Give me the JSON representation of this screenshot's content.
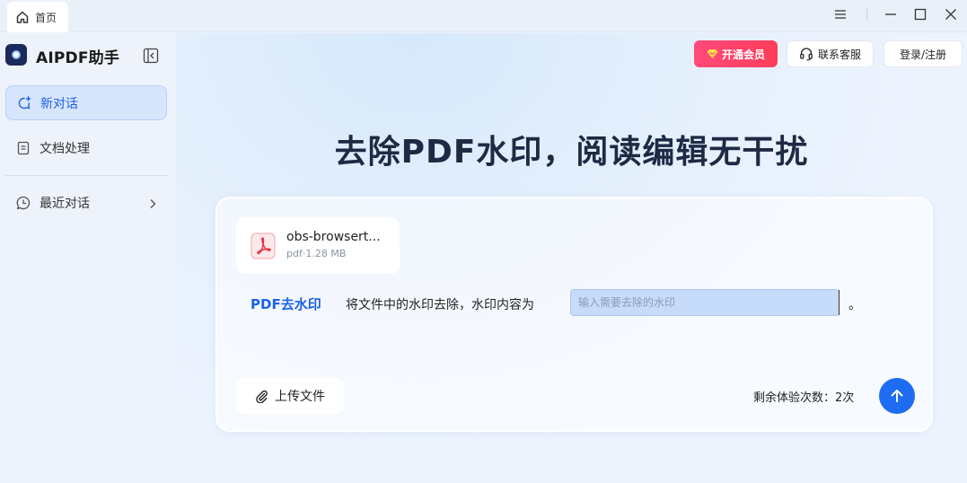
{
  "titlebar": {
    "tab_label": "首页",
    "tab_icon": "home-icon",
    "controls": [
      "menu-icon",
      "minimize-icon",
      "maximize-icon",
      "close-icon"
    ]
  },
  "sidebar": {
    "brand": "AIPDF助手",
    "items": [
      {
        "label": "新对话",
        "icon": "new-chat-icon",
        "active": true
      },
      {
        "label": "文档处理",
        "icon": "document-icon",
        "active": false
      },
      {
        "label": "最近对话",
        "icon": "history-chat-icon",
        "active": false
      }
    ]
  },
  "header": {
    "vip_label": "开通会员",
    "service_label": "联系客服",
    "login_label": "登录/注册"
  },
  "main": {
    "headline": "去除PDF水印，阅读编辑无干扰",
    "file": {
      "name": "obs-browsert...",
      "meta": "pdf·1.28 MB"
    },
    "mode_label": "PDF去水印",
    "instruction": "将文件中的水印去除，水印内容为",
    "watermark_placeholder": "输入需要去除的水印",
    "period": "。",
    "upload_label": "上传文件",
    "remaining": "剩余体验次数：2次"
  },
  "colors": {
    "accent": "#1d61e6",
    "send_button": "#1d6cf2",
    "vip_gradient_start": "#ff4a79",
    "vip_gradient_end": "#ff3d5a",
    "active_nav_bg": "#d7e6fd"
  }
}
